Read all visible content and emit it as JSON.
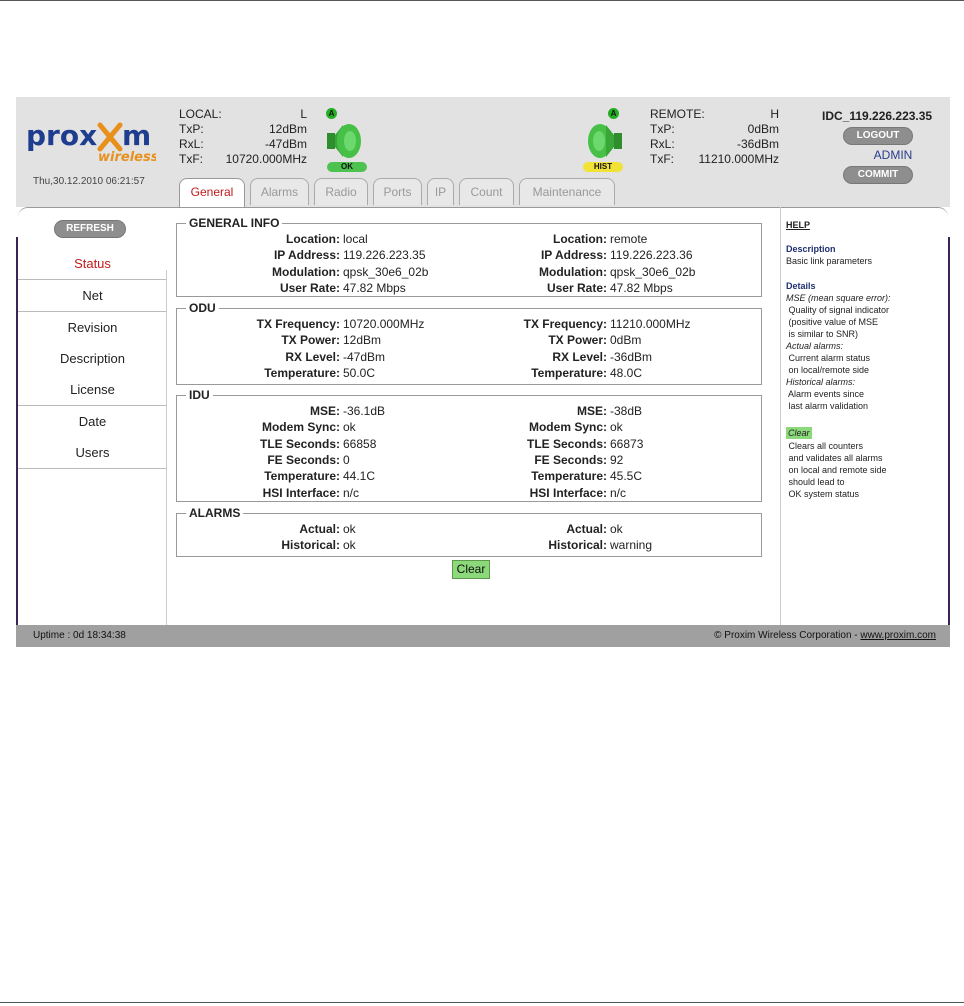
{
  "brand": {
    "name": "proxim",
    "sub": "wireless",
    "colors": {
      "blue": "#1f3d8f",
      "orange": "#e8901c"
    }
  },
  "datetime": "Thu,30.12.2010 06:21:57",
  "local": {
    "label": "LOCAL:",
    "id": "L",
    "txp_label": "TxP:",
    "txp": "12dBm",
    "rxl_label": "RxL:",
    "rxl": "-47dBm",
    "txf_label": "TxF:",
    "txf": "10720.000MHz",
    "indicator": "A",
    "status_badge": "OK"
  },
  "remote": {
    "label": "REMOTE:",
    "id": "H",
    "txp_label": "TxP:",
    "txp": "0dBm",
    "rxl_label": "RxL:",
    "rxl": "-36dBm",
    "txf_label": "TxF:",
    "txf": "11210.000MHz",
    "indicator": "A",
    "status_badge": "HIST"
  },
  "system_name": "IDC_119.226.223.35",
  "logout_label": "LOGOUT",
  "admin_label": "ADMIN",
  "commit_label": "COMMIT",
  "tabs": [
    "General",
    "Alarms",
    "Radio",
    "Ports",
    "IP",
    "Count",
    "Maintenance"
  ],
  "active_tab": "General",
  "refresh_label": "REFRESH",
  "nav": [
    "Status",
    "Net",
    "Revision",
    "Description",
    "License",
    "Date",
    "Users"
  ],
  "active_nav": "Status",
  "sections": {
    "general": {
      "title": "GENERAL INFO",
      "rows": [
        {
          "label": "Location:",
          "local": "local",
          "remote": "remote"
        },
        {
          "label": "IP Address:",
          "local": "119.226.223.35",
          "remote": "119.226.223.36"
        },
        {
          "label": "Modulation:",
          "local": "qpsk_30e6_02b",
          "remote": "qpsk_30e6_02b"
        },
        {
          "label": "User Rate:",
          "local": "47.82 Mbps",
          "remote": "47.82 Mbps"
        }
      ]
    },
    "odu": {
      "title": "ODU",
      "rows": [
        {
          "label": "TX Frequency:",
          "local": "10720.000MHz",
          "remote": "11210.000MHz"
        },
        {
          "label": "TX Power:",
          "local": "12dBm",
          "remote": "0dBm"
        },
        {
          "label": "RX Level:",
          "local": "-47dBm",
          "remote": "-36dBm"
        },
        {
          "label": "Temperature:",
          "local": "50.0C",
          "remote": "48.0C"
        }
      ]
    },
    "idu": {
      "title": "IDU",
      "rows": [
        {
          "label": "MSE:",
          "local": "-36.1dB",
          "remote": "-38dB"
        },
        {
          "label": "Modem Sync:",
          "local": "ok",
          "remote": "ok"
        },
        {
          "label": "TLE Seconds:",
          "local": "66858",
          "remote": "66873"
        },
        {
          "label": "FE Seconds:",
          "local": "0",
          "remote": "92"
        },
        {
          "label": "Temperature:",
          "local": "44.1C",
          "remote": "45.5C"
        },
        {
          "label": "HSI Interface:",
          "local": "n/c",
          "remote": "n/c"
        }
      ]
    },
    "alarms": {
      "title": "ALARMS",
      "rows": [
        {
          "label": "Actual:",
          "local": "ok",
          "remote": "ok"
        },
        {
          "label": "Historical:",
          "local": "ok",
          "remote": "warning"
        }
      ]
    }
  },
  "clear_label": "Clear",
  "help": {
    "title": "HELP",
    "desc_title": "Description",
    "desc_text": "Basic link parameters",
    "details_title": "Details",
    "details": [
      {
        "text": "MSE (mean square error):",
        "italic": true
      },
      {
        "text": " Quality of signal indicator",
        "italic": false
      },
      {
        "text": " (positive value of MSE",
        "italic": false
      },
      {
        "text": " is similar to SNR)",
        "italic": false
      },
      {
        "text": "Actual alarms:",
        "italic": true
      },
      {
        "text": " Current alarm status",
        "italic": false
      },
      {
        "text": " on local/remote side",
        "italic": false
      },
      {
        "text": "Historical alarms:",
        "italic": true
      },
      {
        "text": " Alarm events since",
        "italic": false
      },
      {
        "text": " last alarm validation",
        "italic": false
      }
    ],
    "clear_title": "Clear",
    "clear_lines": [
      " Clears all counters",
      " and validates all alarms",
      " on local and remote side",
      " should lead to",
      " OK system status"
    ]
  },
  "footer": {
    "uptime": "Uptime : 0d 18:34:38",
    "copyright": "© Proxim Wireless Corporation - ",
    "link": "www.proxim.com"
  }
}
